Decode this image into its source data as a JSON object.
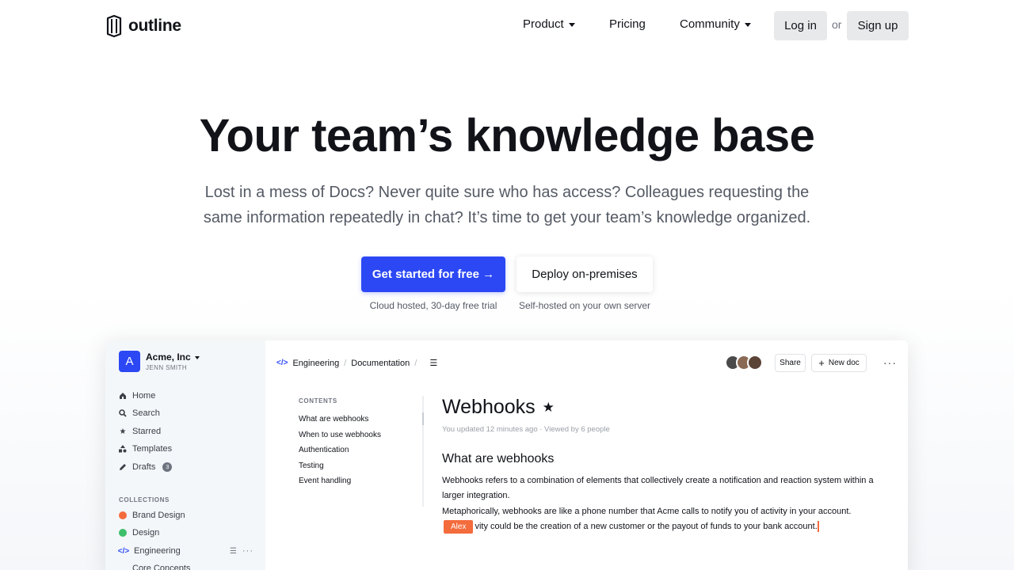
{
  "brand": {
    "name": "outline"
  },
  "nav": {
    "product": "Product",
    "pricing": "Pricing",
    "community": "Community",
    "login": "Log in",
    "or": "or",
    "signup": "Sign up"
  },
  "hero": {
    "title": "Your team’s knowledge base",
    "subtitle": "Lost in a mess of Docs? Never quite sure who has access? Colleagues requesting the same information repeatedly in chat? It’s time to get your team’s knowledge organized.",
    "primary_cta": "Get started for free →",
    "primary_note": "Cloud hosted, 30-day free trial",
    "secondary_cta": "Deploy on-premises",
    "secondary_note": "Self-hosted on your own server"
  },
  "app": {
    "team": {
      "avatar_letter": "A",
      "name": "Acme, Inc",
      "user": "JENN SMITH"
    },
    "sidebar": {
      "items": [
        {
          "label": "Home",
          "icon": "home-icon"
        },
        {
          "label": "Search",
          "icon": "search-icon"
        },
        {
          "label": "Starred",
          "icon": "star-icon"
        },
        {
          "label": "Templates",
          "icon": "shapes-icon"
        },
        {
          "label": "Drafts",
          "icon": "pencil-icon",
          "badge": "3"
        }
      ],
      "collections_heading": "COLLECTIONS",
      "collections": [
        {
          "label": "Brand Design",
          "color": "#f46b3c"
        },
        {
          "label": "Design",
          "color": "#3ebf6b"
        },
        {
          "label": "Engineering",
          "color": "#2c48f4"
        },
        {
          "label": "Core Concepts",
          "color": "#6f7580"
        }
      ]
    },
    "breadcrumb": {
      "collection": "Engineering",
      "sep": "/",
      "document": "Documentation"
    },
    "share_label": "Share",
    "new_doc_label": "New doc",
    "toc": {
      "heading": "CONTENTS",
      "items": [
        "What are webhooks",
        "When to use webhooks",
        "Authentication",
        "Testing",
        "Event handling"
      ]
    },
    "doc": {
      "title": "Webhooks",
      "meta": "You updated 12 minutes ago · Viewed by 6 people",
      "h2": "What are webhooks",
      "p1": "Webhooks refers to a combination of elements that collectively create a notification and reaction system within a larger integration.",
      "p2_start": "Metaphorically, webhooks are like a phone number that Acme calls to notify you of activity in your account.",
      "cursor_name": "Alex",
      "p2_end": "vity could be the creation of a new customer or the payout of funds to your bank account."
    },
    "colors": {
      "accent": "#2c48f4",
      "cursor": "#f46b3c"
    }
  }
}
